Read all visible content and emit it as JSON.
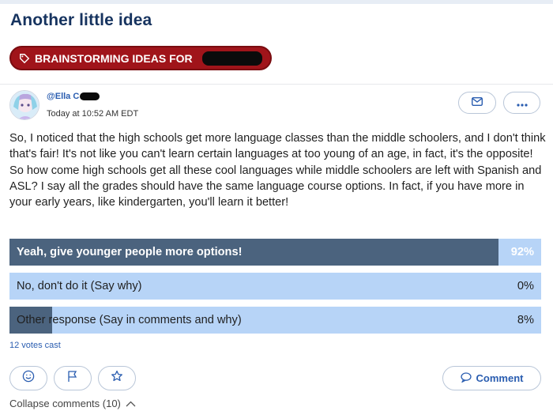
{
  "page": {
    "title": "Another little idea"
  },
  "topic": {
    "label": "BRAINSTORMING IDEAS FOR",
    "icon": "tag-icon"
  },
  "post": {
    "author": "@Ella C",
    "timestamp": "Today at 10:52 AM EDT",
    "body": "So, I noticed that the high schools get more language classes than the middle schoolers, and I don't think that's fair! It's not like you can't learn certain languages at too young of an age, in fact, it's the opposite! So how come high schools get all these cool languages while middle schoolers are left with Spanish and ASL? I say all the grades should have the same language course options. In fact, if you have more in your early years, like kindergarten, you'll learn it better!"
  },
  "poll": {
    "options": [
      {
        "label": "Yeah, give younger people more options!",
        "percent_label": "92%",
        "fraction": 0.92,
        "leading": true
      },
      {
        "label": "No, don't do it (Say why)",
        "percent_label": "0%",
        "fraction": 0.0,
        "leading": false
      },
      {
        "label": "Other response (Say in comments and why)",
        "percent_label": "8%",
        "fraction": 0.08,
        "leading": false
      }
    ],
    "votes": "12 votes cast"
  },
  "actions": {
    "comment_label": "Comment",
    "collapse_label": "Collapse comments (10)"
  },
  "colors": {
    "title": "#16335f",
    "tag_bg": "#a0141a",
    "poll_fill": "#4b637e",
    "poll_track": "#b7d4f7",
    "link": "#2a5db0"
  }
}
